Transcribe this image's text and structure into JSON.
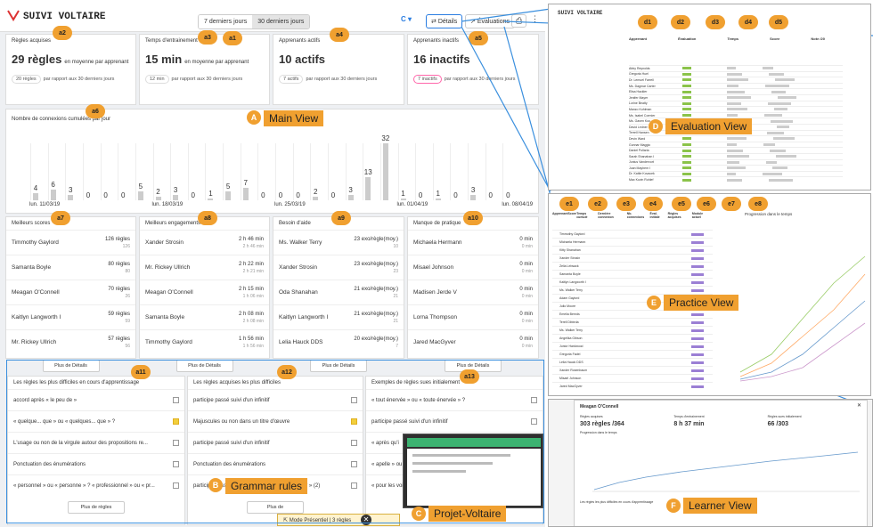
{
  "app": {
    "title": "SUIVI VOLTAIRE"
  },
  "top": {
    "range": [
      "7 derniers jours",
      "30 derniers jours"
    ],
    "c": "C ▾",
    "details": "Détails",
    "evaluations": "Évaluations"
  },
  "stats": [
    {
      "title": "Règles acquises",
      "value": "29 règles",
      "suffix": "en moyenne par apprenant",
      "cmp": "20 règles",
      "cmp_note": "par rapport aux 30 derniers jours"
    },
    {
      "title": "Temps d'entrainement",
      "value": "15 min",
      "suffix": "en moyenne par apprenant",
      "cmp": "12 min",
      "cmp_note": "par rapport aux 30 derniers jours"
    },
    {
      "title": "Apprenants actifs",
      "value": "10 actifs",
      "suffix": "",
      "cmp": "7 actifs",
      "cmp_note": "par rapport aux 30 derniers jours"
    },
    {
      "title": "Apprenants inactifs",
      "value": "16 inactifs",
      "suffix": "",
      "cmp": "7 inactifs",
      "cmp_note": "par rapport aux 30 derniers jours"
    }
  ],
  "connections": {
    "title": "Nombre de connexions cumulées par jour",
    "dates": [
      "lun. 11/03/19",
      "lun. 18/03/19",
      "lun. 25/03/19",
      "lun. 01/04/19",
      "lun. 08/04/19"
    ],
    "labels": [
      "4",
      "6",
      "3",
      "0",
      "0",
      "0",
      "5",
      "2",
      "3",
      "0",
      "1",
      "5",
      "7",
      "0",
      "0",
      "0",
      "2",
      "0",
      "3",
      "13",
      "32",
      "1",
      "0",
      "1",
      "0",
      "3",
      "0",
      "0"
    ]
  },
  "chart_data": {
    "type": "bar",
    "title": "Nombre de connexions cumulées par jour",
    "values": [
      4,
      6,
      3,
      0,
      0,
      0,
      5,
      2,
      3,
      0,
      1,
      5,
      7,
      0,
      0,
      0,
      2,
      0,
      3,
      13,
      32,
      1,
      0,
      1,
      0,
      3,
      0,
      0
    ]
  },
  "lists": [
    {
      "title": "Meilleurs scores",
      "rows": [
        [
          "Timmothy Gaylord",
          "126 règles",
          "126"
        ],
        [
          "Samanta Boyle",
          "80 règles",
          "80"
        ],
        [
          "Meagan O'Connell",
          "70 règles",
          "26"
        ],
        [
          "Kaitlyn Langworth I",
          "59 règles",
          "59"
        ],
        [
          "Mr. Rickey Ullrich",
          "57 règles",
          "56"
        ]
      ]
    },
    {
      "title": "Meilleurs engagements",
      "rows": [
        [
          "Xander Strosin",
          "2 h 46 min",
          "2 h 46 min"
        ],
        [
          "Mr. Rickey Ullrich",
          "2 h 22 min",
          "2 h 21 min"
        ],
        [
          "Meagan O'Connell",
          "2 h 15 min",
          "1 h 06 min"
        ],
        [
          "Samanta Boyle",
          "2 h 08 min",
          "2 h 08 min"
        ],
        [
          "Timmothy Gaylord",
          "1 h 56 min",
          "1 h 56 min"
        ]
      ]
    },
    {
      "title": "Besoin d'aide",
      "rows": [
        [
          "Ms. Walker Terry",
          "23 exo/règle(moy.)",
          "10"
        ],
        [
          "Xander Strosin",
          "23 exo/règle(moy.)",
          "23"
        ],
        [
          "Oda Shanahan",
          "21 exo/règle(moy.)",
          "21"
        ],
        [
          "Kaitlyn Langworth I",
          "21 exo/règle(moy.)",
          "21"
        ],
        [
          "Lelia Hauck DDS",
          "20 exo/règle(moy.)",
          "7"
        ]
      ]
    },
    {
      "title": "Manque de pratique",
      "rows": [
        [
          "Michaela Hermann",
          "0 min",
          "0 min"
        ],
        [
          "Misael Johnson",
          "0 min",
          "0 min"
        ],
        [
          "Madisen Jerde V",
          "0 min",
          "0 min"
        ],
        [
          "Lorna Thompson",
          "0 min",
          "0 min"
        ],
        [
          "Jared MacGyver",
          "0 min",
          "0 min"
        ]
      ]
    }
  ],
  "more": "Plus de Détails",
  "grammar": [
    {
      "title": "Les règles les plus difficiles en cours d'apprentissage",
      "rows": [
        [
          "accord après « le peu de »",
          false
        ],
        [
          "« quelque... que » ou « quelques... que » ?",
          true
        ],
        [
          "L'usage ou non de la virgule autour des propositions re...",
          false
        ],
        [
          "Ponctuation des énumérations",
          false
        ],
        [
          "« personnel » ou « personne » ? « professionnel » ou « pr...",
          false
        ]
      ],
      "more": "Plus de règles"
    },
    {
      "title": "Les règles acquises les plus difficiles",
      "rows": [
        [
          "participe passé suivi d'un infinitif",
          false
        ],
        [
          "Majuscules ou non dans un titre d'œuvre",
          true
        ],
        [
          "participe passé suivi d'un infinitif",
          false
        ],
        [
          "Ponctuation des énumérations",
          false
        ],
        [
          "participe passé conjugué avec l'auxiliaire « avoir » (2)",
          false
        ]
      ],
      "more": "Plus de"
    },
    {
      "title": "Exemples de règles sues initialement",
      "rows": [
        [
          "« tout énervée » ou « toute énervée » ?",
          false
        ],
        [
          "participe passé suivi d'un infinitif",
          false
        ],
        [
          "« après qu'i",
          false
        ],
        [
          "« apelle » ou",
          false
        ],
        [
          "« pour les voi",
          false
        ]
      ],
      "more": ""
    }
  ],
  "popup": {
    "label": "Mode Présentiel | 3 règles"
  },
  "badges": {
    "a1": "a1",
    "a2": "a2",
    "a3": "a3",
    "a4": "a4",
    "a5": "a5",
    "a6": "a6",
    "a7": "a7",
    "a8": "a8",
    "a9": "a9",
    "a10": "a10",
    "a11": "a11",
    "a12": "a12",
    "a13": "a13"
  },
  "views": {
    "A": "A",
    "A_label": "Main View",
    "B": "B",
    "B_label": "Grammar rules",
    "C": "C",
    "C_label": "Projet-Voltaire",
    "D": "D",
    "D_label": "Evaluation View",
    "E": "E",
    "E_label": "Practice View",
    "F": "F",
    "F_label": "Learner View"
  },
  "eval": {
    "badges": [
      "d1",
      "d2",
      "d3",
      "d4",
      "d5"
    ],
    "headers": [
      "Apprenant",
      "Évaluation",
      "Temps",
      "Score",
      "Note /20"
    ],
    "names": [
      "Abby Reynolds",
      "Gregoria Huel",
      "Dr. Lemuel Farrell",
      "Ms. Dagmar Carter",
      "Elisa Hackler",
      "Jenifer Mayer",
      "Lorine Beatty",
      "Manzo Kuhlman",
      "Ms. Isabel Cormier",
      "Ms. Gaven Koo",
      "David Ledner IV",
      "Terrell Hansen",
      "Devin Ward",
      "Gunnar Maggio",
      "Daniel Pollaria",
      "Sarah Shanahan I",
      "Junius Vandervort",
      "Juan Mayhem I",
      "Dr. Kattie Kovacek",
      "Max Kovin Rohlef"
    ]
  },
  "practice": {
    "badges": [
      "e1",
      "e2",
      "e3",
      "e4",
      "e5",
      "e6",
      "e7",
      "e8"
    ],
    "headers": [
      "Apprenant",
      "Score",
      "Temps cumulé",
      "Dernière connexion",
      "Nb. connexions",
      "Éval. initiale",
      "Règles acquises",
      "Module actuel"
    ],
    "names": [
      "Timmothy Gaylord",
      "Michaela Hermann",
      "Kitty Shanahan",
      "Xander Strosin",
      "Zelia Lebsack",
      "Samanta Boyle",
      "Kaitlyn Langworth I",
      "Ms. Walker Terry",
      "Adam Gaylord",
      "Julio Moore",
      "Emelia Bernds",
      "Terell Dibbrda",
      "Ms. Walker Terry",
      "Angelika Gibson",
      "Junior Hardwood",
      "Gregoria Fadel",
      "Lelia Hauck DDS",
      "Xander Rosenbaum",
      "Misael Johnson",
      "Jared MacGyver"
    ],
    "right_title": "Progression dans le temps"
  },
  "learner": {
    "name": "Meagan O'Connell",
    "stats": [
      [
        "Règles acquises",
        "303 règles /364"
      ],
      [
        "Temps d'entrainement",
        "8 h 37 min"
      ],
      [
        "Règles sues initialement",
        "66 /303"
      ]
    ],
    "chart_title": "Progression dans le temps",
    "rules_title": "Les règles les plus difficiles en cours d'apprentissage"
  }
}
